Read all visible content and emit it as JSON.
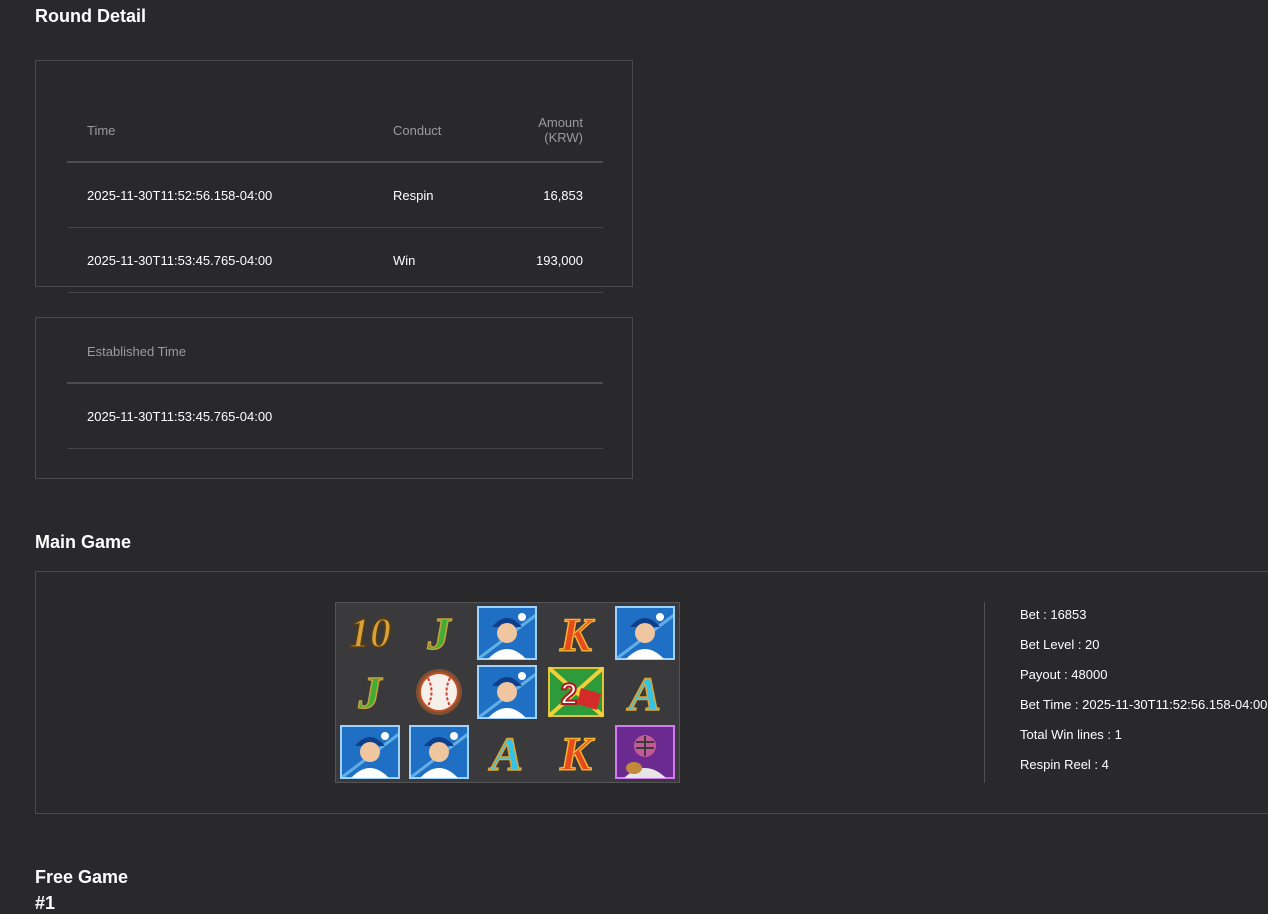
{
  "round_detail": {
    "title": "Round Detail",
    "table": {
      "headers": {
        "time": "Time",
        "conduct": "Conduct",
        "amount": "Amount (KRW)"
      },
      "rows": [
        {
          "time": "2025-11-30T11:52:56.158-04:00",
          "conduct": "Respin",
          "amount": "16,853"
        },
        {
          "time": "2025-11-30T11:53:45.765-04:00",
          "conduct": "Win",
          "amount": "193,000"
        }
      ]
    },
    "established": {
      "header": "Established Time",
      "value": "2025-11-30T11:53:45.765-04:00"
    }
  },
  "main_game": {
    "title": "Main Game",
    "reels": [
      [
        "ten-icon",
        "j-icon",
        "pitcher-icon",
        "k-icon",
        "pitcher-icon"
      ],
      [
        "j-icon",
        "baseball-icon",
        "pitcher-icon",
        "multiplier-2-icon",
        "a-icon"
      ],
      [
        "pitcher-icon",
        "pitcher-icon",
        "a-icon",
        "k-icon",
        "catcher-icon"
      ]
    ],
    "symbol_text": {
      "ten": "10",
      "j": "J",
      "k": "K",
      "a": "A",
      "multiplier": "2"
    },
    "info": {
      "bet": "Bet : 16853",
      "bet_level": "Bet Level : 20",
      "payout": "Payout : 48000",
      "bet_time": "Bet Time : 2025-11-30T11:52:56.158-04:00",
      "total_win_lines": "Total Win lines : 1",
      "respin_reel": "Respin Reel : 4"
    }
  },
  "free_game": {
    "title": "Free Game",
    "index": "#1"
  },
  "colors": {
    "background": "#29282a",
    "border": "#4a494b",
    "header_text": "#9b9b9b",
    "text": "#ffffff"
  }
}
